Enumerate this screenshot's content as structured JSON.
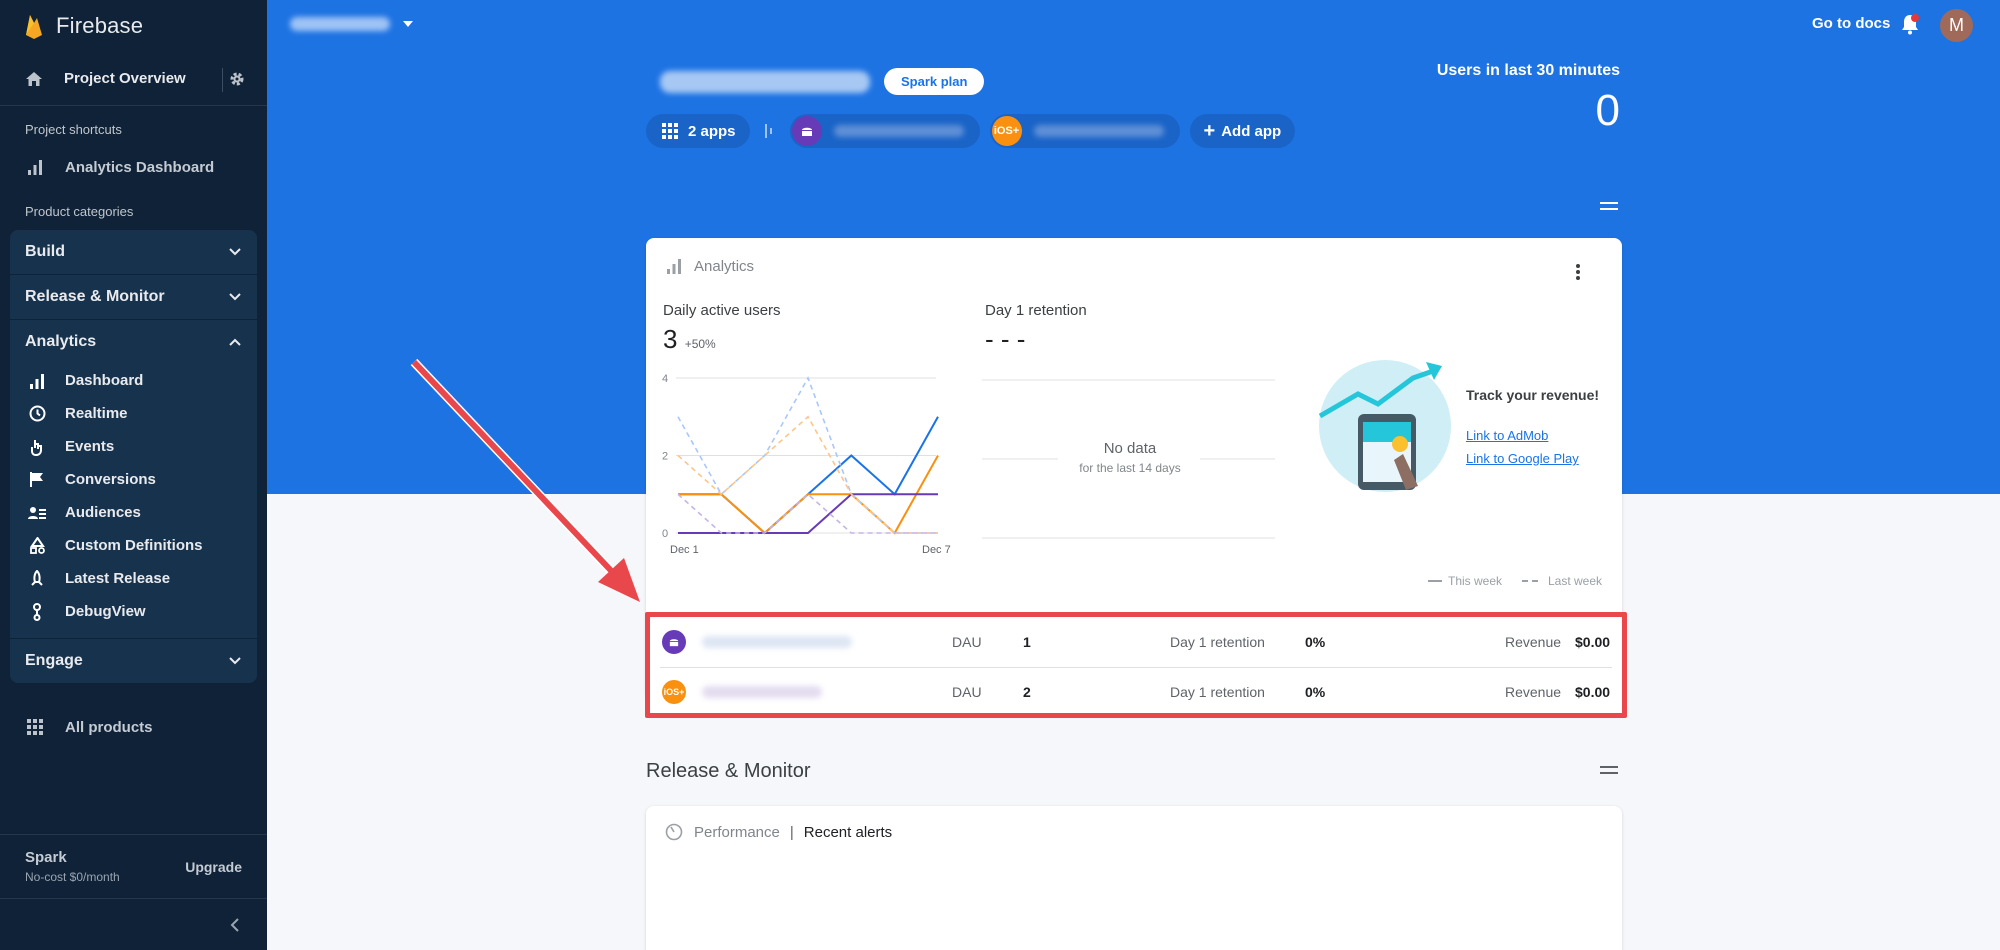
{
  "sidebar": {
    "brand": "Firebase",
    "project_overview": "Project Overview",
    "shortcuts_label": "Project shortcuts",
    "shortcut_analytics": "Analytics Dashboard",
    "categories_label": "Product categories",
    "build": "Build",
    "release_monitor": "Release & Monitor",
    "analytics": "Analytics",
    "analytics_items": [
      "Dashboard",
      "Realtime",
      "Events",
      "Conversions",
      "Audiences",
      "Custom Definitions",
      "Latest Release",
      "DebugView"
    ],
    "engage": "Engage",
    "all_products": "All products",
    "plan_name": "Spark",
    "plan_desc": "No-cost $0/month",
    "upgrade": "Upgrade"
  },
  "header": {
    "go_to_docs": "Go to docs",
    "avatar_initial": "M",
    "plan_badge": "Spark plan",
    "apps_count": "2 apps",
    "ios_badge": "iOS+",
    "add_app": "Add app",
    "users_label": "Users in last 30 minutes",
    "users_value": "0"
  },
  "analytics_card": {
    "title": "Analytics",
    "dau_label": "Daily active users",
    "dau_value": "3",
    "dau_change": "+50%",
    "retention_label": "Day 1 retention",
    "retention_value": "- - -",
    "no_data": "No data",
    "no_data_sub": "for the last 14 days",
    "revenue_title": "Track your revenue!",
    "link_admob": "Link to AdMob",
    "link_play": "Link to Google Play",
    "legend_this": "This week",
    "legend_last": "Last week"
  },
  "chart_data": {
    "type": "line",
    "title": "Daily active users",
    "x": [
      "Dec 1",
      "Dec 2",
      "Dec 3",
      "Dec 4",
      "Dec 5",
      "Dec 6",
      "Dec 7"
    ],
    "x_tick_labels": [
      "Dec 1",
      "Dec 7"
    ],
    "yticks": [
      0,
      2,
      4
    ],
    "ylim": [
      0,
      4
    ],
    "grid": true,
    "series": [
      {
        "name": "This week",
        "values": [
          1,
          1,
          0,
          1,
          2,
          1,
          3
        ],
        "color": "#1a73e8",
        "dash": false
      },
      {
        "name": "This week",
        "values": [
          1,
          1,
          0,
          1,
          1,
          0,
          2
        ],
        "color": "#f9900f",
        "dash": false
      },
      {
        "name": "This week",
        "values": [
          0,
          0,
          0,
          0,
          1,
          1,
          1
        ],
        "color": "#673ab7",
        "dash": false
      },
      {
        "name": "Last week",
        "values": [
          3,
          1,
          2,
          4,
          1,
          0,
          0
        ],
        "color": "#a8c7fa",
        "dash": true
      },
      {
        "name": "Last week",
        "values": [
          2,
          1,
          2,
          3,
          1,
          0,
          0
        ],
        "color": "#fcc58a",
        "dash": true
      },
      {
        "name": "Last week",
        "values": [
          1,
          0,
          0,
          1,
          0,
          0,
          0
        ],
        "color": "#c5b3e6",
        "dash": true
      }
    ]
  },
  "app_rows": [
    {
      "dau_label": "DAU",
      "dau": "1",
      "ret_label": "Day 1 retention",
      "ret": "0%",
      "rev_label": "Revenue",
      "rev": "$0.00"
    },
    {
      "dau_label": "DAU",
      "dau": "2",
      "ret_label": "Day 1 retention",
      "ret": "0%",
      "rev_label": "Revenue",
      "rev": "$0.00"
    }
  ],
  "release": {
    "title": "Release & Monitor",
    "perf": "Performance",
    "sep": "|",
    "alerts": "Recent alerts"
  },
  "colors": {
    "hero_blue": "#1e73e3",
    "sidebar_bg": "#0f2237",
    "android_purple": "#673ab7",
    "ios_orange": "#f9900f",
    "highlight_red": "#e8474c"
  }
}
